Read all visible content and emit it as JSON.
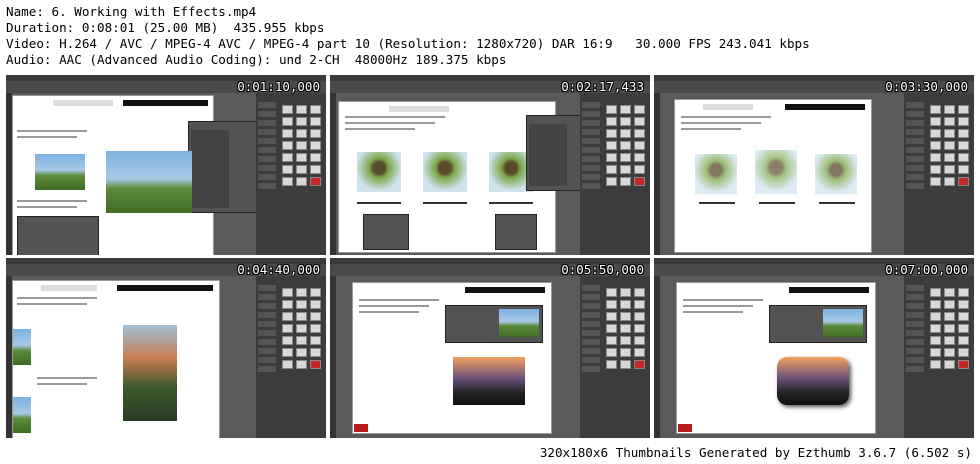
{
  "meta": {
    "name_line": "Name: 6. Working with Effects.mp4",
    "duration_line": "Duration: 0:08:01 (25.00 MB)  435.955 kbps",
    "video_line": "Video: H.264 / AVC / MPEG-4 AVC / MPEG-4 part 10 (Resolution: 1280x720) DAR 16:9   30.000 FPS 243.041 kbps",
    "audio_line": "Audio: AAC (Advanced Audio Coding): und 2-CH  48000Hz 189.375 kbps"
  },
  "thumbnails": [
    {
      "timestamp": "0:01:10,000",
      "scene": "drop-shadow-dialog"
    },
    {
      "timestamp": "0:02:17,433",
      "scene": "feather-dialog"
    },
    {
      "timestamp": "0:03:30,000",
      "scene": "feather-result"
    },
    {
      "timestamp": "0:04:40,000",
      "scene": "corner-effects"
    },
    {
      "timestamp": "0:05:50,000",
      "scene": "object-styles"
    },
    {
      "timestamp": "0:07:00,000",
      "scene": "object-styles-applied"
    }
  ],
  "footer": "320x180x6 Thumbnails Generated by Ezthumb 3.6.7 (6.502 s)"
}
